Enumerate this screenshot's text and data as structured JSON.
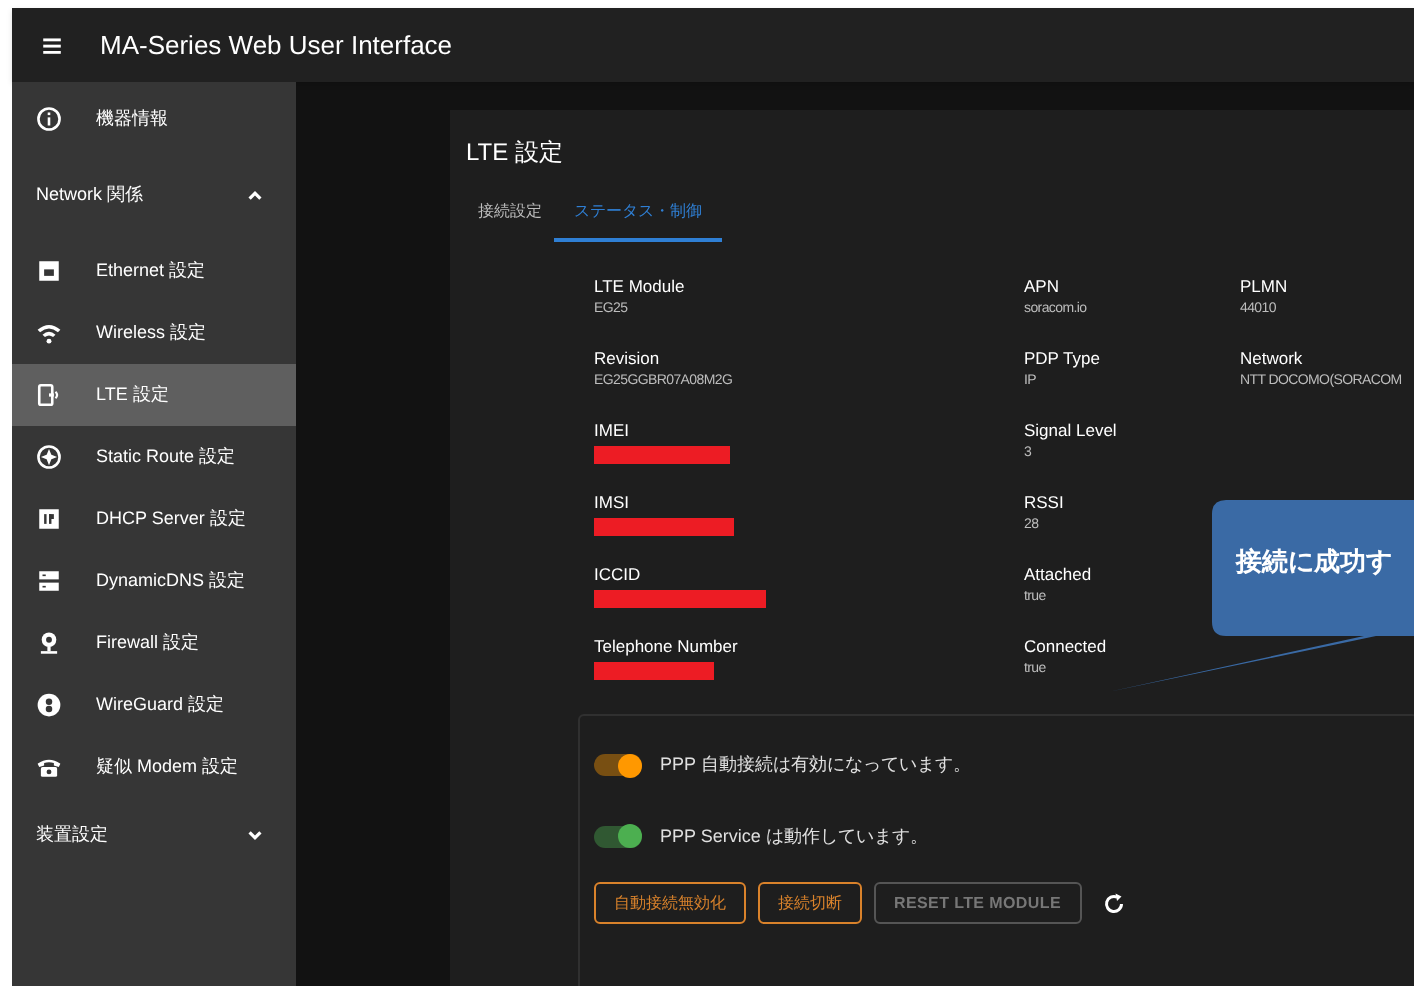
{
  "app_bar": {
    "menu_icon": "≡",
    "title": "MA-Series Web User Interface"
  },
  "sidebar": [
    {
      "kind": "item",
      "label": "機器情報",
      "selected": false
    },
    {
      "kind": "group",
      "label": "Network 関係",
      "expanded": true,
      "children": [
        {
          "label": "Ethernet 設定",
          "selected": false
        },
        {
          "label": "Wireless 設定",
          "selected": false
        },
        {
          "label": "LTE 設定",
          "selected": true
        },
        {
          "label": "Static Route 設定",
          "selected": false
        },
        {
          "label": "DHCP Server 設定",
          "selected": false
        },
        {
          "label": "DynamicDNS 設定",
          "selected": false
        },
        {
          "label": "Firewall 設定",
          "selected": false
        },
        {
          "label": "WireGuard 設定",
          "selected": false
        },
        {
          "label": "疑似 Modem 設定",
          "selected": false
        }
      ]
    },
    {
      "kind": "group",
      "label": "装置設定",
      "expanded": false
    }
  ],
  "card": {
    "title": "LTE 設定",
    "tabs": [
      {
        "label": "接続設定",
        "selected": false
      },
      {
        "label": "ステータス・制御",
        "selected": true
      }
    ],
    "columns": [
      [
        {
          "label": "LTE Module",
          "value": "EG25"
        },
        {
          "label": "Revision",
          "value": "EG25GGBR07A08M2G"
        },
        {
          "label": "IMEI",
          "redacted": true
        },
        {
          "label": "IMSI",
          "redacted": true
        },
        {
          "label": "ICCID",
          "redacted": true
        },
        {
          "label": "Telephone Number",
          "redacted": true
        }
      ],
      [
        {
          "label": "APN",
          "value": "soracom.io"
        },
        {
          "label": "PDP Type",
          "value": "IP"
        },
        {
          "label": "Signal Level",
          "value": "3"
        },
        {
          "label": "RSSI",
          "value": "28"
        },
        {
          "label": "Attached",
          "value": "true"
        },
        {
          "label": "Connected",
          "value": "true"
        }
      ],
      [
        {
          "label": "PLMN",
          "value": "44010"
        },
        {
          "label": "Network",
          "value": "NTT DOCOMO(SORACOM"
        }
      ]
    ],
    "switches": [
      {
        "label": "PPP 自動接続は有効になっています。",
        "on": true,
        "color": "#ff9800"
      },
      {
        "label": "PPP Service は動作しています。",
        "on": true,
        "color": "#4caf50"
      }
    ],
    "buttons": [
      {
        "label": "自動接続無効化",
        "disabled": false
      },
      {
        "label": "接続切断",
        "disabled": false
      },
      {
        "label": "RESET LTE MODULE",
        "disabled": true
      }
    ]
  },
  "callout": {
    "text": "接続に成功す"
  }
}
